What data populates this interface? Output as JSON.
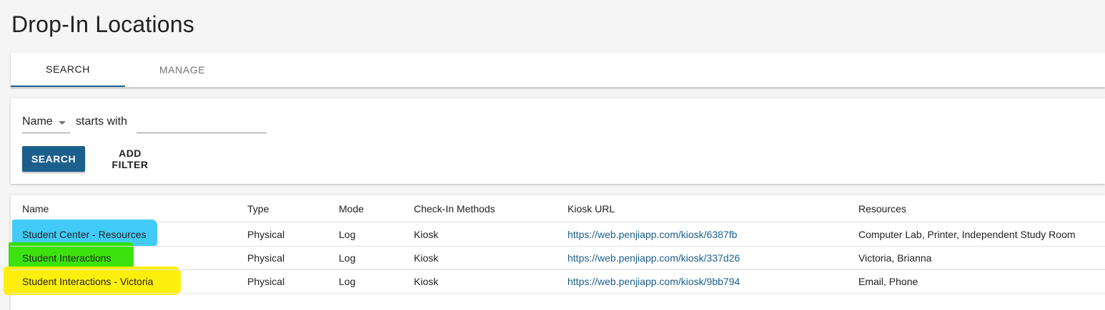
{
  "page": {
    "title": "Drop-In Locations"
  },
  "tabs": [
    {
      "label": "SEARCH",
      "active": true
    },
    {
      "label": "MANAGE",
      "active": false
    }
  ],
  "filter": {
    "field": "Name",
    "operator": "starts with",
    "value": "",
    "search_label": "SEARCH",
    "add_filter_label": "ADD FILTER"
  },
  "table": {
    "columns": [
      "Name",
      "Type",
      "Mode",
      "Check-In Methods",
      "Kiosk URL",
      "Resources"
    ],
    "rows": [
      {
        "name": "Student Center - Resources",
        "type": "Physical",
        "mode": "Log",
        "methods": "Kiosk",
        "url": "https://web.penjiapp.com/kiosk/6387fb",
        "resources": "Computer Lab, Printer, Independent Study Room"
      },
      {
        "name": "Student Interactions",
        "type": "Physical",
        "mode": "Log",
        "methods": "Kiosk",
        "url": "https://web.penjiapp.com/kiosk/337d26",
        "resources": "Victoria, Brianna"
      },
      {
        "name": "Student Interactions - Victoria",
        "type": "Physical",
        "mode": "Log",
        "methods": "Kiosk",
        "url": "https://web.penjiapp.com/kiosk/9bb794",
        "resources": "Email, Phone"
      }
    ]
  },
  "highlights": {
    "row0": "#38c8f5",
    "row1": "#32e000",
    "row2": "#ffee00"
  },
  "colors": {
    "accent": "#1b5f8c"
  }
}
